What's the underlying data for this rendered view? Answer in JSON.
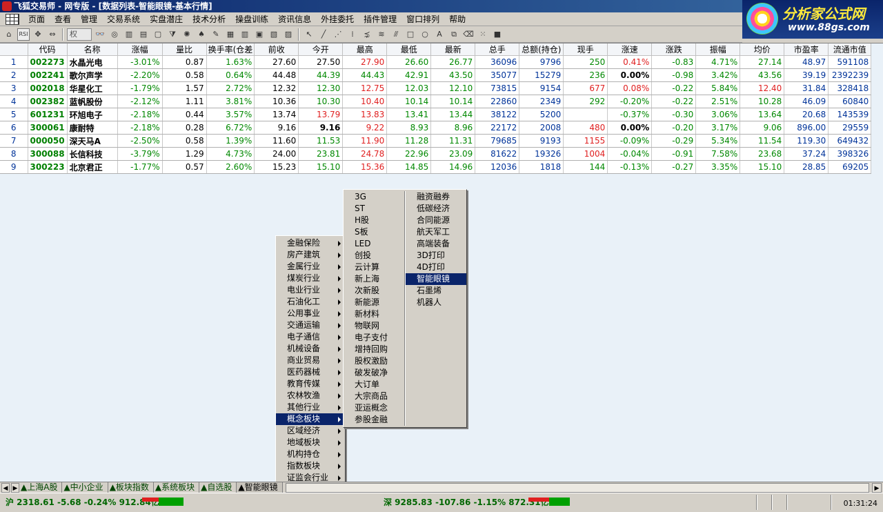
{
  "window": {
    "title": "飞狐交易师 - 网专版 - [数据列表-智能眼镜-基本行情]"
  },
  "logo": {
    "name": "分析家公式网",
    "url": "www.88gs.com"
  },
  "menu": [
    "页面",
    "查看",
    "管理",
    "交易系统",
    "实盘潜庄",
    "技术分析",
    "操盘训练",
    "资讯信息",
    "外挂委托",
    "插件管理",
    "窗口排列",
    "帮助"
  ],
  "toolbar": {
    "combo_label": "权"
  },
  "table": {
    "headers": [
      "",
      "代码",
      "名称",
      "涨幅",
      "量比",
      "换手率(仓差",
      "前收",
      "今开",
      "最高",
      "最低",
      "最新",
      "总手",
      "总额(持仓)",
      "现手",
      "涨速",
      "涨跌",
      "振幅",
      "均价",
      "市盈率",
      "流通市值"
    ],
    "rows": [
      [
        "1",
        "002273",
        "水晶光电",
        "-3.01%",
        "0.87",
        "1.63%",
        "27.60",
        "27.50",
        "27.90",
        "26.60",
        "26.77",
        "36096",
        "9796",
        "250",
        "0.41%",
        "-0.83",
        "4.71%",
        "27.14",
        "48.97",
        "591108"
      ],
      [
        "2",
        "002241",
        "歌尔声学",
        "-2.20%",
        "0.58",
        "0.64%",
        "44.48",
        "44.39",
        "44.43",
        "42.91",
        "43.50",
        "35077",
        "15279",
        "236",
        "0.00%",
        "-0.98",
        "3.42%",
        "43.56",
        "39.19",
        "2392239"
      ],
      [
        "3",
        "002018",
        "华星化工",
        "-1.79%",
        "1.57",
        "2.72%",
        "12.32",
        "12.30",
        "12.75",
        "12.03",
        "12.10",
        "73815",
        "9154",
        "677",
        "0.08%",
        "-0.22",
        "5.84%",
        "12.40",
        "31.84",
        "328418"
      ],
      [
        "4",
        "002382",
        "蓝帆股份",
        "-2.12%",
        "1.11",
        "3.81%",
        "10.36",
        "10.30",
        "10.40",
        "10.14",
        "10.14",
        "22860",
        "2349",
        "292",
        "-0.20%",
        "-0.22",
        "2.51%",
        "10.28",
        "46.09",
        "60840"
      ],
      [
        "5",
        "601231",
        "环旭电子",
        "-2.18%",
        "0.44",
        "3.57%",
        "13.74",
        "13.79",
        "13.83",
        "13.41",
        "13.44",
        "38122",
        "5200",
        "",
        "-0.37%",
        "-0.30",
        "3.06%",
        "13.64",
        "20.68",
        "143539"
      ],
      [
        "6",
        "300061",
        "康耐特",
        "-2.18%",
        "0.28",
        "6.72%",
        "9.16",
        "9.16",
        "9.22",
        "8.93",
        "8.96",
        "22172",
        "2008",
        "480",
        "0.00%",
        "-0.20",
        "3.17%",
        "9.06",
        "896.00",
        "29559"
      ],
      [
        "7",
        "000050",
        "深天马A",
        "-2.50%",
        "0.58",
        "1.39%",
        "11.60",
        "11.53",
        "11.90",
        "11.28",
        "11.31",
        "79685",
        "9193",
        "1155",
        "-0.09%",
        "-0.29",
        "5.34%",
        "11.54",
        "119.30",
        "649432"
      ],
      [
        "8",
        "300088",
        "长信科技",
        "-3.79%",
        "1.29",
        "4.73%",
        "24.00",
        "23.81",
        "24.78",
        "22.96",
        "23.09",
        "81622",
        "19326",
        "1004",
        "-0.04%",
        "-0.91",
        "7.58%",
        "23.68",
        "37.24",
        "398326"
      ],
      [
        "9",
        "300223",
        "北京君正",
        "-1.77%",
        "0.57",
        "2.60%",
        "15.23",
        "15.10",
        "15.36",
        "14.85",
        "14.96",
        "12036",
        "1818",
        "144",
        "-0.13%",
        "-0.27",
        "3.35%",
        "15.10",
        "28.85",
        "69205"
      ]
    ]
  },
  "menu1": [
    "金融保险",
    "房产建筑",
    "金属行业",
    "煤炭行业",
    "电业行业",
    "石油化工",
    "公用事业",
    "交通运输",
    "电子通信",
    "机械设备",
    "商业贸易",
    "医药器械",
    "教育传媒",
    "农林牧渔",
    "其他行业",
    "概念板块",
    "区域经济",
    "地域板块",
    "机构持仓",
    "指数板块",
    "证监会行业"
  ],
  "menu2": [
    "3G",
    "ST",
    "H股",
    "S板",
    "LED",
    "创投",
    "云计算",
    "新上海",
    "次新股",
    "新能源",
    "新材料",
    "物联网",
    "电子支付",
    "增持回购",
    "股权激励",
    "破发破净",
    "大订单",
    "大宗商品",
    "亚运概念",
    "参股金融"
  ],
  "menu3": [
    "融资融券",
    "低碳经济",
    "合同能源",
    "航天军工",
    "高端装备",
    "3D打印",
    "4D打印",
    "智能眼镜",
    "石墨烯",
    "机器人"
  ],
  "tabs": [
    "▲上海A股",
    "▲中小企业",
    "▲板块指数",
    "▲系统板块",
    "▲自选股",
    "▲智能眼镜"
  ],
  "status": {
    "sh": "沪 2318.61 -5.68 -0.24% 912.84亿",
    "sz": "深 9285.83 -107.86 -1.15% 872.31亿",
    "time": "01:31:24"
  }
}
